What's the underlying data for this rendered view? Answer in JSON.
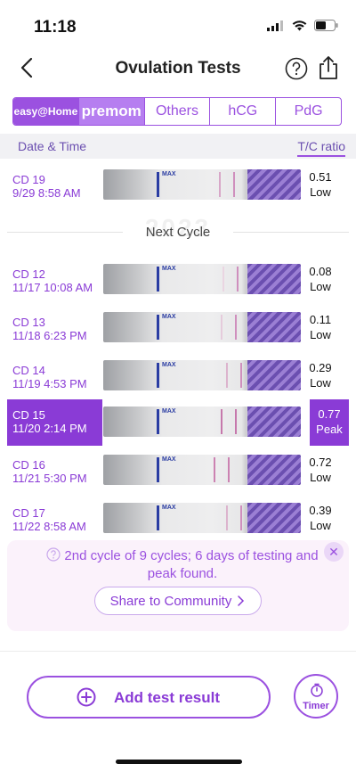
{
  "status_bar": {
    "time": "11:18"
  },
  "nav": {
    "title": "Ovulation Tests"
  },
  "tabs": [
    {
      "label": "easy@Home",
      "kind": "brand"
    },
    {
      "label": "premom",
      "kind": "premom"
    },
    {
      "label": "Others"
    },
    {
      "label": "hCG"
    },
    {
      "label": "PdG"
    }
  ],
  "header": {
    "left": "Date & Time",
    "right": "T/C ratio"
  },
  "separator": {
    "year_watermark": "2023",
    "label": "Next Cycle"
  },
  "rows": [
    {
      "cd": "CD 19",
      "datetime": "9/29 8:58 AM",
      "ratio": "0.51",
      "level": "Low"
    },
    {
      "cd": "CD 12",
      "datetime": "11/17 10:08 AM",
      "ratio": "0.08",
      "level": "Low"
    },
    {
      "cd": "CD 13",
      "datetime": "11/18 6:23 PM",
      "ratio": "0.11",
      "level": "Low"
    },
    {
      "cd": "CD 14",
      "datetime": "11/19 4:53 PM",
      "ratio": "0.29",
      "level": "Low"
    },
    {
      "cd": "CD 15",
      "datetime": "11/20 2:14 PM",
      "ratio": "0.77",
      "level": "Peak"
    },
    {
      "cd": "CD 16",
      "datetime": "11/21 5:30 PM",
      "ratio": "0.72",
      "level": "Low"
    },
    {
      "cd": "CD 17",
      "datetime": "11/22 8:58 AM",
      "ratio": "0.39",
      "level": "Low"
    }
  ],
  "strip_labels": {
    "max": "MAX"
  },
  "info": {
    "text": "2nd cycle of 9 cycles; 6 days of testing and peak found.",
    "share_button": "Share to Community"
  },
  "bottom": {
    "add_button": "Add test result",
    "timer_button": "Timer"
  },
  "colors": {
    "accent": "#9b51e0",
    "accent_dark": "#8a3bd6",
    "header_bg": "#f1f1f4"
  },
  "icons": {
    "back": "chevron-left-icon",
    "help": "question-circle-icon",
    "share": "share-icon",
    "add": "plus-circle-icon",
    "timer": "stopwatch-icon"
  }
}
